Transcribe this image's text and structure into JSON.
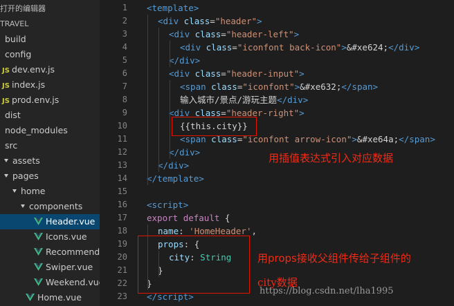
{
  "explorer": {
    "open_editors_label": "打开的编辑器",
    "project_label": "TRAVEL",
    "items": [
      {
        "label": "build",
        "kind": "folder",
        "indent": 0,
        "arrow": false
      },
      {
        "label": "config",
        "kind": "folder",
        "indent": 0,
        "arrow": false
      },
      {
        "label": "dev.env.js",
        "kind": "js",
        "indent": 0,
        "arrow": false
      },
      {
        "label": "index.js",
        "kind": "js",
        "indent": 0,
        "arrow": false
      },
      {
        "label": "prod.env.js",
        "kind": "js",
        "indent": 0,
        "arrow": false
      },
      {
        "label": "dist",
        "kind": "folder",
        "indent": 0,
        "arrow": false
      },
      {
        "label": "node_modules",
        "kind": "folder",
        "indent": 0,
        "arrow": false
      },
      {
        "label": "src",
        "kind": "folder",
        "indent": 0,
        "arrow": false
      },
      {
        "label": "assets",
        "kind": "folder",
        "indent": 1,
        "arrow": true
      },
      {
        "label": "pages",
        "kind": "folder",
        "indent": 1,
        "arrow": true
      },
      {
        "label": "home",
        "kind": "folder",
        "indent": 2,
        "arrow": true
      },
      {
        "label": "components",
        "kind": "folder",
        "indent": 3,
        "arrow": true
      },
      {
        "label": "Header.vue",
        "kind": "vue",
        "indent": 4,
        "arrow": false,
        "selected": true
      },
      {
        "label": "Icons.vue",
        "kind": "vue",
        "indent": 4,
        "arrow": false
      },
      {
        "label": "Recommend.v...",
        "kind": "vue",
        "indent": 4,
        "arrow": false
      },
      {
        "label": "Swiper.vue",
        "kind": "vue",
        "indent": 4,
        "arrow": false
      },
      {
        "label": "Weekend.vue",
        "kind": "vue",
        "indent": 4,
        "arrow": false
      },
      {
        "label": "Home.vue",
        "kind": "vue",
        "indent": 3,
        "arrow": false
      }
    ]
  },
  "editor": {
    "lines": [
      {
        "n": "1",
        "indent": 0,
        "tokens": [
          [
            "<",
            "tag"
          ],
          [
            "template",
            "tag"
          ],
          [
            ">",
            "tag"
          ]
        ]
      },
      {
        "n": "2",
        "indent": 1,
        "tokens": [
          [
            "<",
            "tag"
          ],
          [
            "div",
            "tag"
          ],
          [
            " ",
            ""
          ],
          [
            "class",
            "attr"
          ],
          [
            "=",
            ""
          ],
          [
            "\"header\"",
            "str"
          ],
          [
            ">",
            "tag"
          ]
        ]
      },
      {
        "n": "3",
        "indent": 2,
        "tokens": [
          [
            "<",
            "tag"
          ],
          [
            "div",
            "tag"
          ],
          [
            " ",
            ""
          ],
          [
            "class",
            "attr"
          ],
          [
            "=",
            ""
          ],
          [
            "\"header-left\"",
            "str"
          ],
          [
            ">",
            "tag"
          ]
        ]
      },
      {
        "n": "4",
        "indent": 3,
        "tokens": [
          [
            "<",
            "tag"
          ],
          [
            "div",
            "tag"
          ],
          [
            " ",
            ""
          ],
          [
            "class",
            "attr"
          ],
          [
            "=",
            ""
          ],
          [
            "\"iconfont back-icon\"",
            "str"
          ],
          [
            ">",
            "tag"
          ],
          [
            "&#xe624;",
            ""
          ],
          [
            "</",
            "tag"
          ],
          [
            "div",
            "tag"
          ],
          [
            ">",
            "tag"
          ]
        ]
      },
      {
        "n": "5",
        "indent": 2,
        "tokens": [
          [
            "</",
            "tag"
          ],
          [
            "div",
            "tag"
          ],
          [
            ">",
            "tag"
          ]
        ]
      },
      {
        "n": "6",
        "indent": 2,
        "tokens": [
          [
            "<",
            "tag"
          ],
          [
            "div",
            "tag"
          ],
          [
            " ",
            ""
          ],
          [
            "class",
            "attr"
          ],
          [
            "=",
            ""
          ],
          [
            "\"header-input\"",
            "str"
          ],
          [
            ">",
            "tag"
          ]
        ]
      },
      {
        "n": "7",
        "indent": 3,
        "tokens": [
          [
            "<",
            "tag"
          ],
          [
            "span",
            "tag"
          ],
          [
            " ",
            ""
          ],
          [
            "class",
            "attr"
          ],
          [
            "=",
            ""
          ],
          [
            "\"iconfont\"",
            "str"
          ],
          [
            ">",
            "tag"
          ],
          [
            "&#xe632;",
            ""
          ],
          [
            "</",
            "tag"
          ],
          [
            "span",
            "tag"
          ],
          [
            ">",
            "tag"
          ]
        ]
      },
      {
        "n": "8",
        "indent": 3,
        "tokens": [
          [
            "输入城市/景点/游玩主题",
            ""
          ],
          [
            "</",
            "tag"
          ],
          [
            "div",
            "tag"
          ],
          [
            ">",
            "tag"
          ]
        ]
      },
      {
        "n": "9",
        "indent": 2,
        "tokens": [
          [
            "<",
            "tag"
          ],
          [
            "div",
            "tag"
          ],
          [
            " ",
            ""
          ],
          [
            "class",
            "attr"
          ],
          [
            "=",
            ""
          ],
          [
            "\"header-right\"",
            "str"
          ],
          [
            ">",
            "tag"
          ]
        ]
      },
      {
        "n": "10",
        "indent": 3,
        "tokens": [
          [
            "{{this.city}}",
            ""
          ]
        ]
      },
      {
        "n": "11",
        "indent": 3,
        "tokens": [
          [
            "<",
            "tag"
          ],
          [
            "span",
            "tag"
          ],
          [
            " ",
            ""
          ],
          [
            "class",
            "attr"
          ],
          [
            "=",
            ""
          ],
          [
            "\"iconfont arrow-icon\"",
            "str"
          ],
          [
            ">",
            "tag"
          ],
          [
            "&#xe64a;",
            ""
          ],
          [
            "</",
            "tag"
          ],
          [
            "span",
            "tag"
          ],
          [
            ">",
            "tag"
          ]
        ]
      },
      {
        "n": "12",
        "indent": 2,
        "tokens": [
          [
            "</",
            "tag"
          ],
          [
            "div",
            "tag"
          ],
          [
            ">",
            "tag"
          ]
        ]
      },
      {
        "n": "13",
        "indent": 1,
        "tokens": [
          [
            "</",
            "tag"
          ],
          [
            "div",
            "tag"
          ],
          [
            ">",
            "tag"
          ]
        ]
      },
      {
        "n": "14",
        "indent": 0,
        "tokens": [
          [
            "</",
            "tag"
          ],
          [
            "template",
            "tag"
          ],
          [
            ">",
            "tag"
          ]
        ]
      },
      {
        "n": "15",
        "indent": 0,
        "tokens": []
      },
      {
        "n": "16",
        "indent": 0,
        "tokens": [
          [
            "<",
            "tag"
          ],
          [
            "script",
            "tag"
          ],
          [
            ">",
            "tag"
          ]
        ]
      },
      {
        "n": "17",
        "indent": 0,
        "tokens": [
          [
            "export",
            "kw"
          ],
          [
            " ",
            ""
          ],
          [
            "default",
            "kw"
          ],
          [
            " {",
            ""
          ]
        ]
      },
      {
        "n": "18",
        "indent": 1,
        "tokens": [
          [
            "name",
            "prop"
          ],
          [
            ": ",
            ""
          ],
          [
            "'HomeHeader'",
            "str"
          ],
          [
            ",",
            ""
          ]
        ]
      },
      {
        "n": "19",
        "indent": 1,
        "tokens": [
          [
            "props",
            "prop"
          ],
          [
            ": {",
            ""
          ]
        ]
      },
      {
        "n": "20",
        "indent": 2,
        "tokens": [
          [
            "city",
            "prop"
          ],
          [
            ": ",
            ""
          ],
          [
            "String",
            "type"
          ]
        ]
      },
      {
        "n": "21",
        "indent": 1,
        "tokens": [
          [
            "}",
            ""
          ]
        ]
      },
      {
        "n": "22",
        "indent": 0,
        "tokens": [
          [
            "}",
            ""
          ]
        ]
      },
      {
        "n": "23",
        "indent": 0,
        "tokens": [
          [
            "</",
            "tag"
          ],
          [
            "script",
            "tag"
          ],
          [
            ">",
            "tag"
          ]
        ]
      }
    ]
  },
  "annotations": {
    "interp_note": "用插值表达式引入对应数据",
    "props_note_1": "用props接收父组件传给子组件的",
    "props_note_2": "city数据"
  },
  "watermark": "https://blog.csdn.net/lha1995",
  "colors": {
    "tag": "#569cd6",
    "attr": "#9cdcfe",
    "str": "#ce9178",
    "kw": "#c586c0",
    "prop": "#9cdcfe",
    "type": "#4ec9b0",
    "plain": "#d4d4d4",
    "annotation": "#f22a16"
  }
}
